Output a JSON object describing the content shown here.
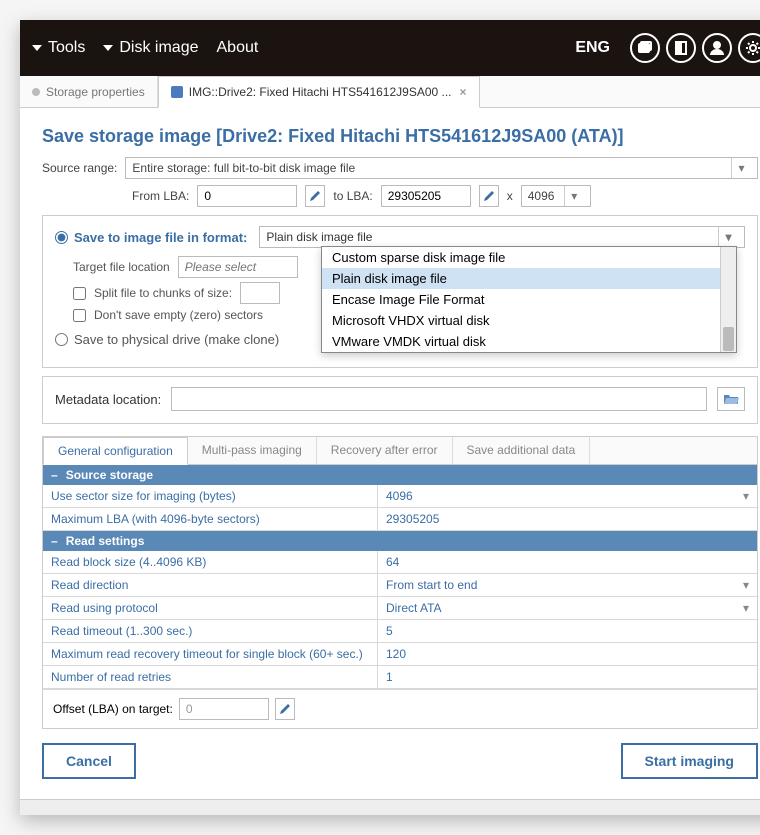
{
  "topbar": {
    "menu": {
      "tools": "Tools",
      "disk_image": "Disk image",
      "about": "About"
    },
    "lang": "ENG"
  },
  "tabs": {
    "storage_props": "Storage properties",
    "active": "IMG::Drive2: Fixed Hitachi HTS541612J9SA00 ..."
  },
  "title": "Save storage image [Drive2: Fixed Hitachi HTS541612J9SA00 (ATA)]",
  "source": {
    "label": "Source range:",
    "value": "Entire storage: full bit-to-bit disk image file",
    "from_label": "From LBA:",
    "from_value": "0",
    "to_label": "to LBA:",
    "to_value": "29305205",
    "x": "x",
    "mult": "4096"
  },
  "save": {
    "radio_file": "Save to image file in format:",
    "format_selected": "Plain disk image file",
    "target_label": "Target file location",
    "target_placeholder": "Please select",
    "split_label": "Split file to chunks of size:",
    "no_empty_label": "Don't save empty (zero) sectors",
    "radio_drive": "Save to physical drive (make clone)",
    "dropdown_options": [
      "Custom sparse disk image file",
      "Plain disk image file",
      "Encase Image File Format",
      "Microsoft VHDX virtual disk",
      "VMware VMDK virtual disk"
    ]
  },
  "metadata": {
    "label": "Metadata location:"
  },
  "subtabs": {
    "general": "General configuration",
    "multipass": "Multi-pass imaging",
    "recovery": "Recovery after error",
    "additional": "Save additional data"
  },
  "grid": {
    "grp_source": "Source storage",
    "sector_size": {
      "k": "Use sector size for imaging (bytes)",
      "v": "4096"
    },
    "max_lba": {
      "k": "Maximum LBA (with 4096-byte sectors)",
      "v": "29305205"
    },
    "grp_read": "Read settings",
    "block_size": {
      "k": "Read block size (4..4096 KB)",
      "v": "64"
    },
    "direction": {
      "k": "Read direction",
      "v": "From start to end"
    },
    "protocol": {
      "k": "Read using protocol",
      "v": "Direct ATA"
    },
    "timeout": {
      "k": "Read timeout (1..300 sec.)",
      "v": "5"
    },
    "recovery_timeout": {
      "k": "Maximum read recovery timeout for single block (60+ sec.)",
      "v": "120"
    },
    "retries": {
      "k": "Number of read retries",
      "v": "1"
    }
  },
  "offset": {
    "label": "Offset (LBA) on target:",
    "value": "0"
  },
  "buttons": {
    "cancel": "Cancel",
    "start": "Start imaging"
  }
}
